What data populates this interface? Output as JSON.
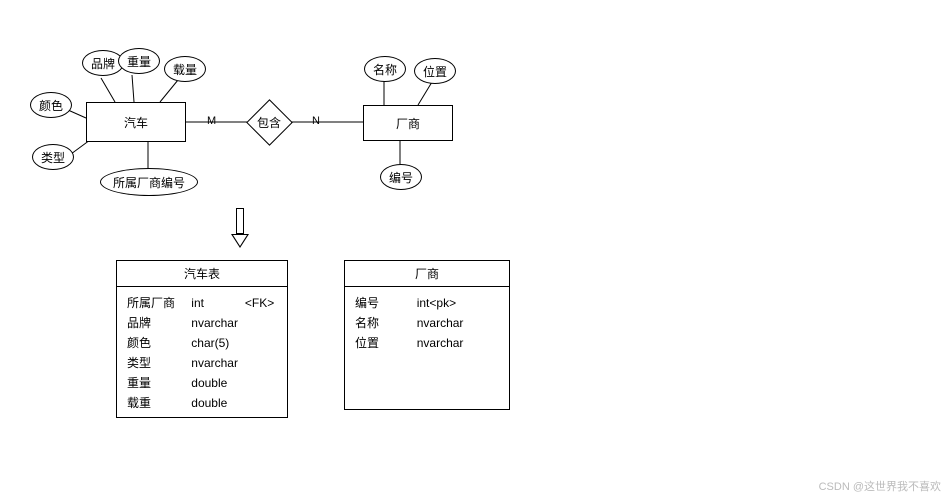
{
  "er": {
    "car": {
      "name": "汽车",
      "attrs": {
        "brand": "品牌",
        "weight": "重量",
        "load": "载量",
        "color": "颜色",
        "type": "类型",
        "fk": "所属厂商编号"
      }
    },
    "relationship": {
      "label": "包含",
      "left": "M",
      "right": "N"
    },
    "factory": {
      "name": "厂商",
      "attrs": {
        "name": "名称",
        "location": "位置",
        "id": "编号"
      }
    }
  },
  "tables": {
    "car": {
      "title": "汽车表",
      "rows": [
        {
          "name": "所属厂商",
          "type": "int",
          "key": "<FK>"
        },
        {
          "name": "品牌",
          "type": "nvarchar",
          "key": ""
        },
        {
          "name": "颜色",
          "type": "char(5)",
          "key": ""
        },
        {
          "name": "类型",
          "type": "nvarchar",
          "key": ""
        },
        {
          "name": "重量",
          "type": "double",
          "key": ""
        },
        {
          "name": "载重",
          "type": "double",
          "key": ""
        }
      ]
    },
    "factory": {
      "title": "厂商",
      "rows": [
        {
          "name": "编号",
          "type": "int<pk>",
          "key": ""
        },
        {
          "name": "名称",
          "type": "nvarchar",
          "key": ""
        },
        {
          "name": "位置",
          "type": "nvarchar",
          "key": ""
        }
      ]
    }
  },
  "watermark": "CSDN @这世界我不喜欢",
  "chart_data": {
    "type": "diagram",
    "diagram_type": "ER-to-relational",
    "entities": [
      {
        "name": "汽车",
        "attributes": [
          "品牌",
          "重量",
          "载量",
          "颜色",
          "类型",
          "所属厂商编号"
        ]
      },
      {
        "name": "厂商",
        "attributes": [
          "名称",
          "位置",
          "编号"
        ]
      }
    ],
    "relationships": [
      {
        "name": "包含",
        "between": [
          "汽车",
          "厂商"
        ],
        "cardinality": [
          "M",
          "N"
        ]
      }
    ],
    "tables": [
      {
        "name": "汽车表",
        "columns": [
          {
            "name": "所属厂商",
            "type": "int",
            "constraint": "FK"
          },
          {
            "name": "品牌",
            "type": "nvarchar"
          },
          {
            "name": "颜色",
            "type": "char(5)"
          },
          {
            "name": "类型",
            "type": "nvarchar"
          },
          {
            "name": "重量",
            "type": "double"
          },
          {
            "name": "载重",
            "type": "double"
          }
        ]
      },
      {
        "name": "厂商",
        "columns": [
          {
            "name": "编号",
            "type": "int",
            "constraint": "pk"
          },
          {
            "name": "名称",
            "type": "nvarchar"
          },
          {
            "name": "位置",
            "type": "nvarchar"
          }
        ]
      }
    ]
  }
}
